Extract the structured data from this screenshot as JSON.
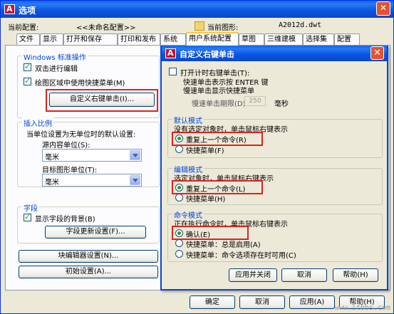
{
  "window": {
    "title": "选项",
    "close_glyph": "✕"
  },
  "config": {
    "current_profile_label": "当前配置:",
    "current_profile_value": "<<未命名配置>>",
    "current_drawing_label": "当前图形:",
    "current_drawing_value": "A2012d.dwt"
  },
  "tabs": [
    "文件",
    "显示",
    "打开和保存",
    "打印和发布",
    "系统",
    "用户系统配置",
    "草图",
    "三维建模",
    "选择集",
    "配置"
  ],
  "active_tab": "用户系统配置",
  "windows_group": {
    "label": "Windows 标准操作",
    "double_click_edit": "双击进行编辑",
    "shortcut_menu_in_drawing": "绘图区域中使用快捷菜单(M)",
    "custom_right_click_button": "自定义右键单击(I)..."
  },
  "insert_scale": {
    "label": "插入比例",
    "description": "当单位设置为无单位时的默认设置:",
    "source_units_label": "源内容单位(S):",
    "source_units_value": "毫米",
    "target_units_label": "目标图形单位(T):",
    "target_units_value": "毫米"
  },
  "fields": {
    "label": "字段",
    "show_background": "显示字段的背景(B)",
    "update_settings_button": "字段更新设置(F)..."
  },
  "block_editor_button": "块编辑器设置(N)...",
  "initial_setup_button": "初始设置(A)...",
  "bottom_buttons": {
    "ok": "确定",
    "cancel": "取消",
    "apply": "应用(A)",
    "help": "帮助(H)"
  },
  "dialog": {
    "title": "自定义右键单击",
    "timed_right_click": "打开计时右键单击(T):",
    "quick_click_line": "快速单击表示按 ENTER 键",
    "slow_click_line": "慢速单击显示快捷菜单",
    "slow_click_duration_label": "慢速单击期限(D):",
    "slow_click_duration_value": "250",
    "slow_click_unit": "毫秒",
    "default_mode": {
      "label": "默认模式",
      "description": "没有选定对象时，单击鼠标右键表示",
      "repeat_last": "重复上一个命令(R)",
      "shortcut_menu": "快捷菜单(F)"
    },
    "edit_mode": {
      "label": "编辑模式",
      "description": "选定对象时，单击鼠标右键表示",
      "repeat_last": "重复上一个命令(L)",
      "shortcut_menu": "快捷菜单(H)"
    },
    "command_mode": {
      "label": "命令模式",
      "description": "正在执行命令时，单击鼠标右键表示",
      "confirm": "确认(E)",
      "shortcut_menu_always": "快捷菜单：总是启用(A)",
      "shortcut_menu_options": "快捷菜单：命令选项存在时可用(C)"
    },
    "buttons": {
      "apply_close": "应用并关闭",
      "cancel": "取消",
      "help": "帮助(H)"
    }
  },
  "watermark": "www.itbbs.com"
}
